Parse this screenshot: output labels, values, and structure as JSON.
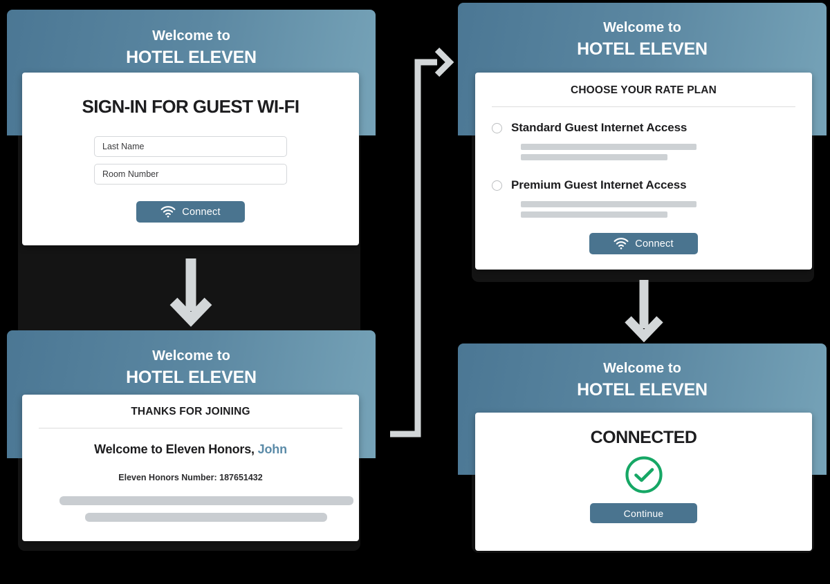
{
  "colors": {
    "header_gradient_start": "#4b7794",
    "header_gradient_end": "#76a3b8",
    "button_blue": "#4a748f",
    "accent_link": "#5b8ba8",
    "success_green": "#16a765",
    "skeleton_gray": "#cdd1d4",
    "background": "#000000"
  },
  "brand": {
    "welcome_prefix": "Welcome to",
    "hotel_name": "HOTEL ELEVEN"
  },
  "screens": [
    {
      "id": "sign-in",
      "heading": "SIGN-IN FOR GUEST WI-FI",
      "fields": [
        {
          "name": "last-name",
          "placeholder": "Last Name",
          "value": ""
        },
        {
          "name": "room-number",
          "placeholder": "Room Number",
          "value": ""
        }
      ],
      "button": {
        "label": "Connect",
        "icon": "wifi-icon"
      }
    },
    {
      "id": "rate-plan",
      "heading": "CHOOSE YOUR RATE PLAN",
      "plans": [
        {
          "label": "Standard Guest Internet Access",
          "selected": false
        },
        {
          "label": "Premium Guest Internet Access",
          "selected": false
        }
      ],
      "button": {
        "label": "Connect",
        "icon": "wifi-icon"
      }
    },
    {
      "id": "thanks-for-joining",
      "heading": "THANKS FOR JOINING",
      "welcome_message_prefix": "Welcome to Eleven Honors,",
      "member_name": "John",
      "honors_number_label": "Eleven Honors Number:",
      "honors_number": "187651432"
    },
    {
      "id": "connected",
      "heading": "CONNECTED",
      "status_icon": "check-circle-icon",
      "button": {
        "label": "Continue"
      }
    }
  ],
  "flow": {
    "arrows": [
      {
        "name": "arrow-signin-to-thanks",
        "direction": "down"
      },
      {
        "name": "arrow-thanks-to-rateplan",
        "direction": "right-elbow"
      },
      {
        "name": "arrow-rateplan-to-connected",
        "direction": "down"
      }
    ]
  }
}
